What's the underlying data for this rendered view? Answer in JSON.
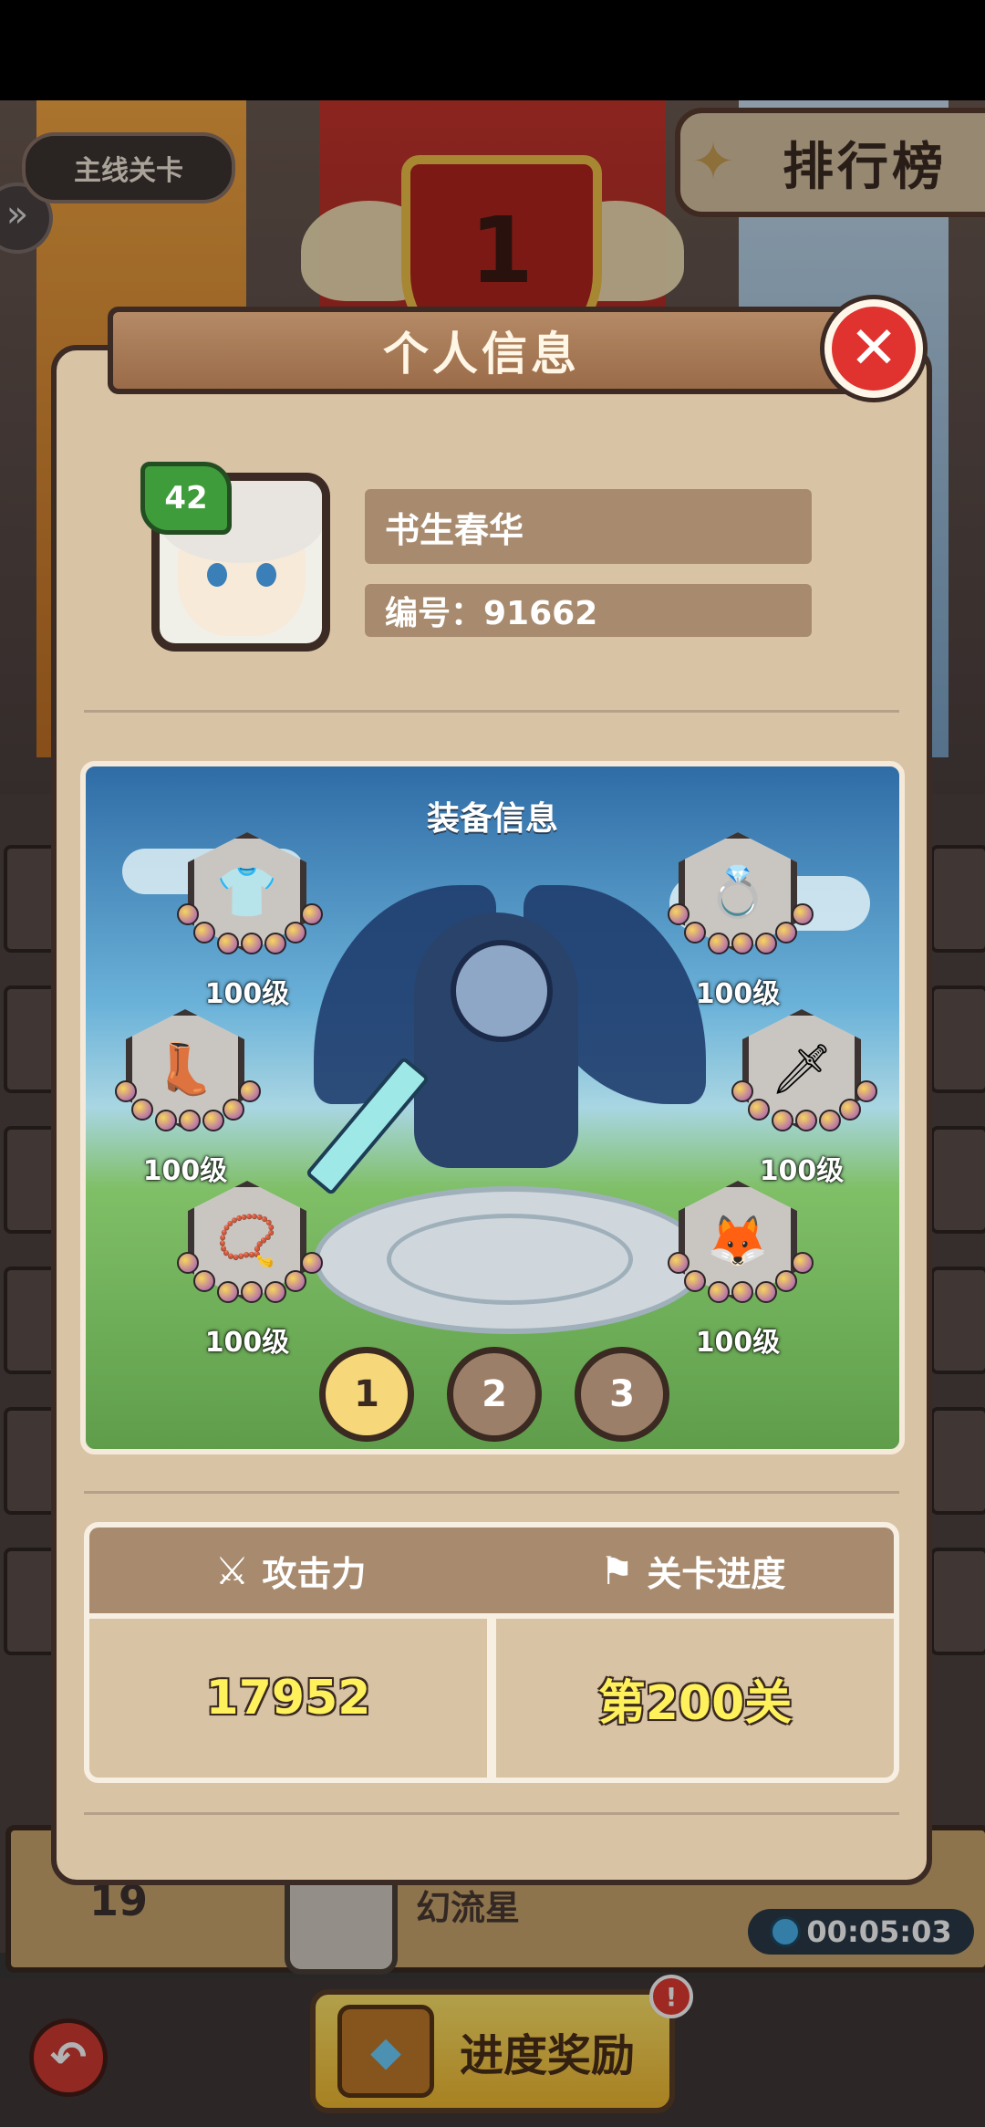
{
  "background": {
    "mainline_button": "主线关卡",
    "ranking_tab": "排行榜",
    "rank_number": "1",
    "row19": {
      "rank": "19",
      "name": "幻流星",
      "timer": "00:05:03"
    },
    "reward_button": "进度奖励",
    "alert_badge": "!"
  },
  "modal": {
    "title": "个人信息",
    "close_glyph": "✕",
    "profile": {
      "level": "42",
      "name": "书生春华",
      "id_text": "编号：91662"
    },
    "equipment": {
      "title": "装备信息",
      "slots": [
        {
          "icon": "chestplate-icon",
          "glyph": "👕",
          "level": "100级"
        },
        {
          "icon": "ring-icon",
          "glyph": "💍",
          "level": "100级"
        },
        {
          "icon": "boots-icon",
          "glyph": "👢",
          "level": "100级"
        },
        {
          "icon": "sword-icon",
          "glyph": "🗡",
          "level": "100级"
        },
        {
          "icon": "necklace-icon",
          "glyph": "📿",
          "level": "100级"
        },
        {
          "icon": "fox-mask-icon",
          "glyph": "🦊",
          "level": "100级"
        }
      ],
      "pages": [
        "1",
        "2",
        "3"
      ],
      "active_page": "1"
    },
    "stats": {
      "attack_label": "攻击力",
      "progress_label": "关卡进度",
      "attack_value": "17952",
      "progress_value": "第200关"
    }
  },
  "colors": {
    "modal_bg": "#d9c3a5",
    "header_brown": "#a88b6f",
    "value_yellow": "#fff15c",
    "close_red": "#e0322f",
    "level_green": "#3e9c3a"
  }
}
